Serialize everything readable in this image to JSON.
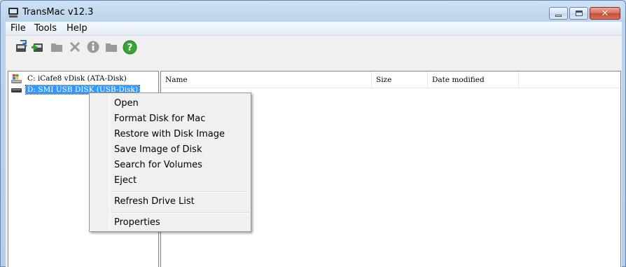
{
  "window": {
    "title": "TransMac v12.3"
  },
  "menu": {
    "items": [
      "File",
      "Tools",
      "Help"
    ]
  },
  "toolbar": {
    "icons": [
      "open-disk-icon",
      "add-disk-icon",
      "folder-icon",
      "delete-icon",
      "info-icon",
      "new-folder-icon",
      "help-icon"
    ]
  },
  "tree": {
    "items": [
      {
        "label": "C: iCafe8 vDisk (ATA-Disk)",
        "icon": "hard-drive-windows-icon",
        "selected": false
      },
      {
        "label": "D: SMI USB DISK (USB-Disk)",
        "icon": "usb-drive-icon",
        "selected": true
      }
    ]
  },
  "file_list": {
    "columns": [
      "Name",
      "Size",
      "Date modified"
    ]
  },
  "context_menu": {
    "items": [
      "Open",
      "Format Disk for Mac",
      "Restore with Disk Image",
      "Save Image of Disk",
      "Search for Volumes",
      "Eject",
      "Refresh Drive List",
      "Properties"
    ]
  },
  "colors": {
    "selection": "#3399ff",
    "help_green": "#3aa53a"
  }
}
